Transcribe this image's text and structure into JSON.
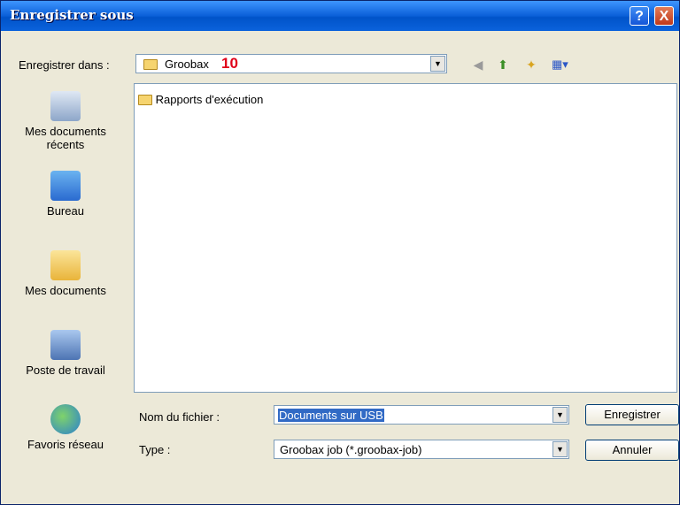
{
  "window": {
    "title": "Enregistrer sous",
    "help_label": "?",
    "close_label": "X"
  },
  "location": {
    "label": "Enregistrer dans :",
    "folder": "Groobax",
    "badge": "10"
  },
  "toolbar": {
    "icons": [
      "back-icon",
      "up-folder-icon",
      "new-folder-icon",
      "views-icon"
    ]
  },
  "places": [
    {
      "label": "Mes documents récents",
      "icon": "recent-documents-icon"
    },
    {
      "label": "Bureau",
      "icon": "desktop-icon"
    },
    {
      "label": "Mes documents",
      "icon": "my-documents-icon"
    },
    {
      "label": "Poste de travail",
      "icon": "my-computer-icon"
    },
    {
      "label": "Favoris réseau",
      "icon": "network-places-icon"
    }
  ],
  "files": [
    {
      "name": "Rapports d'exécution",
      "icon": "folder-icon"
    }
  ],
  "form": {
    "filename_label": "Nom du fichier :",
    "filename_value": "Documents sur USB",
    "type_label": "Type :",
    "type_value": "Groobax job (*.groobax-job)"
  },
  "buttons": {
    "save": "Enregistrer",
    "cancel": "Annuler"
  },
  "colors": {
    "title_bar": "#0a5fd8",
    "close_button": "#c0391a",
    "dialog_bg": "#ece9d8",
    "badge": "#e0001a"
  }
}
